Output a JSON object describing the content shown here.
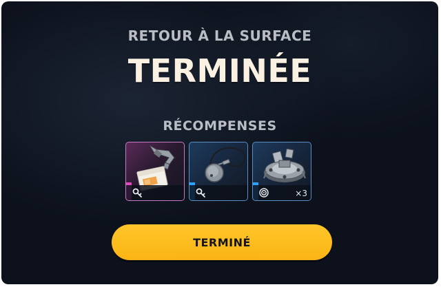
{
  "header": {
    "subtitle": "RETOUR À LA SURFACE",
    "title": "TERMINÉE"
  },
  "rewards": {
    "heading": "RÉCOMPENSES",
    "items": [
      {
        "rarity": "epic",
        "accent_color": "#e04ac0",
        "item_icon": "access-card-icon",
        "tag_icon": "key-icon",
        "quantity": ""
      },
      {
        "rarity": "rare",
        "accent_color": "#2ba3ff",
        "item_icon": "dog-tag-pendant-icon",
        "tag_icon": "key-icon",
        "quantity": ""
      },
      {
        "rarity": "rare",
        "accent_color": "#2ba3ff",
        "item_icon": "mechanical-part-icon",
        "tag_icon": "target-icon",
        "quantity": "×3"
      }
    ]
  },
  "button": {
    "label": "TERMINÉ",
    "color": "#fbb414"
  }
}
